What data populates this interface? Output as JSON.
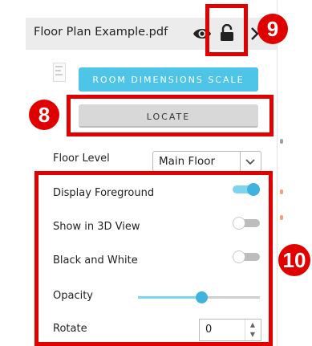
{
  "file": {
    "name": "Floor Plan Example.pdf",
    "eye_icon": "eye-icon",
    "lock_icon": "unlocked-lock-icon"
  },
  "buttons": {
    "room_dimensions_scale": "ROOM DIMENSIONS SCALE",
    "locate": "LOCATE"
  },
  "floor_level": {
    "label": "Floor Level",
    "selected": "Main Floor"
  },
  "settings": {
    "display_foreground": {
      "label": "Display Foreground",
      "on": true
    },
    "show_in_3d_view": {
      "label": "Show in 3D View",
      "on": false
    },
    "black_and_white": {
      "label": "Black and White",
      "on": false
    },
    "opacity": {
      "label": "Opacity",
      "value_fraction": 0.52
    },
    "rotate": {
      "label": "Rotate",
      "value": "0"
    }
  },
  "annotations": {
    "badge_8": "8",
    "badge_9": "9",
    "badge_10": "10"
  },
  "colors": {
    "accent": "#4ec4e7",
    "toggle_on": "#3fb3de",
    "annotation_red": "#e00000"
  }
}
